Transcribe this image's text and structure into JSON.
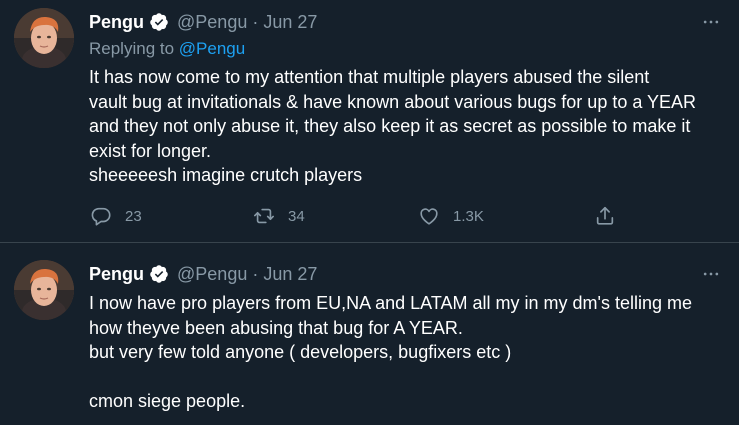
{
  "colors": {
    "background": "#15202b",
    "text": "#ffffff",
    "secondary": "#8899a6",
    "link": "#1da1f2",
    "divider": "#38444d"
  },
  "tweets": [
    {
      "author": "Pengu",
      "handle": "@Pengu",
      "separator": "·",
      "date": "Jun 27",
      "verified_icon": "verified-badge-icon",
      "replying_label": "Replying to",
      "replying_to": "@Pengu",
      "lines": [
        "It has now come to my attention that multiple players abused the silent",
        "vault bug at invitationals & have known about various bugs for up to a YEAR",
        "and they not only abuse it, they also keep it as secret as possible to make it",
        "exist for longer.",
        "sheeeeesh imagine crutch players"
      ],
      "actions": {
        "replies": "23",
        "retweets": "34",
        "likes": "1.3K",
        "icons": [
          "reply-icon",
          "retweet-icon",
          "like-icon",
          "share-icon"
        ]
      }
    },
    {
      "author": "Pengu",
      "handle": "@Pengu",
      "separator": "·",
      "date": "Jun 27",
      "verified_icon": "verified-badge-icon",
      "lines": [
        "I now have pro players from EU,NA and LATAM all my in my dm's telling me",
        "how theyve been abusing that bug for A YEAR.",
        "but very few told anyone ( developers, bugfixers etc )",
        "",
        "cmon siege people."
      ]
    }
  ]
}
